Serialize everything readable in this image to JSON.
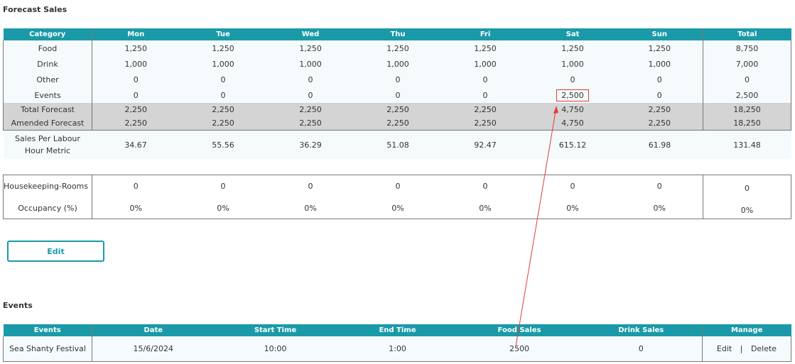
{
  "forecast": {
    "title": "Forecast Sales",
    "headers": [
      "Category",
      "Mon",
      "Tue",
      "Wed",
      "Thu",
      "Fri",
      "Sat",
      "Sun",
      "Total"
    ],
    "rows": [
      {
        "label": "Food",
        "values": [
          "1,250",
          "1,250",
          "1,250",
          "1,250",
          "1,250",
          "1,250",
          "1,250",
          "8,750"
        ]
      },
      {
        "label": "Drink",
        "values": [
          "1,000",
          "1,000",
          "1,000",
          "1,000",
          "1,000",
          "1,000",
          "1,000",
          "7,000"
        ]
      },
      {
        "label": "Other",
        "values": [
          "0",
          "0",
          "0",
          "0",
          "0",
          "0",
          "0",
          "0"
        ]
      },
      {
        "label": "Events",
        "values": [
          "0",
          "0",
          "0",
          "0",
          "0",
          "2,500",
          "0",
          "2,500"
        ]
      }
    ],
    "totals": [
      {
        "label": "Total Forecast",
        "values": [
          "2,250",
          "2,250",
          "2,250",
          "2,250",
          "2,250",
          "4,750",
          "2,250",
          "18,250"
        ]
      },
      {
        "label": "Amended Forecast",
        "values": [
          "2,250",
          "2,250",
          "2,250",
          "2,250",
          "2,250",
          "4,750",
          "2,250",
          "18,250"
        ]
      }
    ],
    "metric": {
      "label": "Sales Per Labour Hour Metric",
      "values": [
        "34.67",
        "55.56",
        "36.29",
        "51.08",
        "92.47",
        "615.12",
        "61.98",
        "131.48"
      ]
    }
  },
  "housekeeping": {
    "rooms": {
      "label": "Housekeeping-Rooms",
      "values": [
        "0",
        "0",
        "0",
        "0",
        "0",
        "0",
        "0",
        "0"
      ]
    },
    "occupancy": {
      "label": "Occupancy (%)",
      "values": [
        "0%",
        "0%",
        "0%",
        "0%",
        "0%",
        "0%",
        "0%",
        "0%"
      ]
    }
  },
  "edit_button": "Edit",
  "events": {
    "title": "Events",
    "headers": [
      "Events",
      "Date",
      "Start Time",
      "End Time",
      "Food Sales",
      "Drink Sales",
      "Manage"
    ],
    "row": {
      "name": "Sea Shanty Festival",
      "date": "15/6/2024",
      "start": "10:00",
      "end": "1:00",
      "food": "2500",
      "drink": "0",
      "edit": "Edit",
      "sep": "|",
      "delete": "Delete"
    }
  },
  "annotation_color": "#e03c3c",
  "accent_color": "#1a9aa8"
}
